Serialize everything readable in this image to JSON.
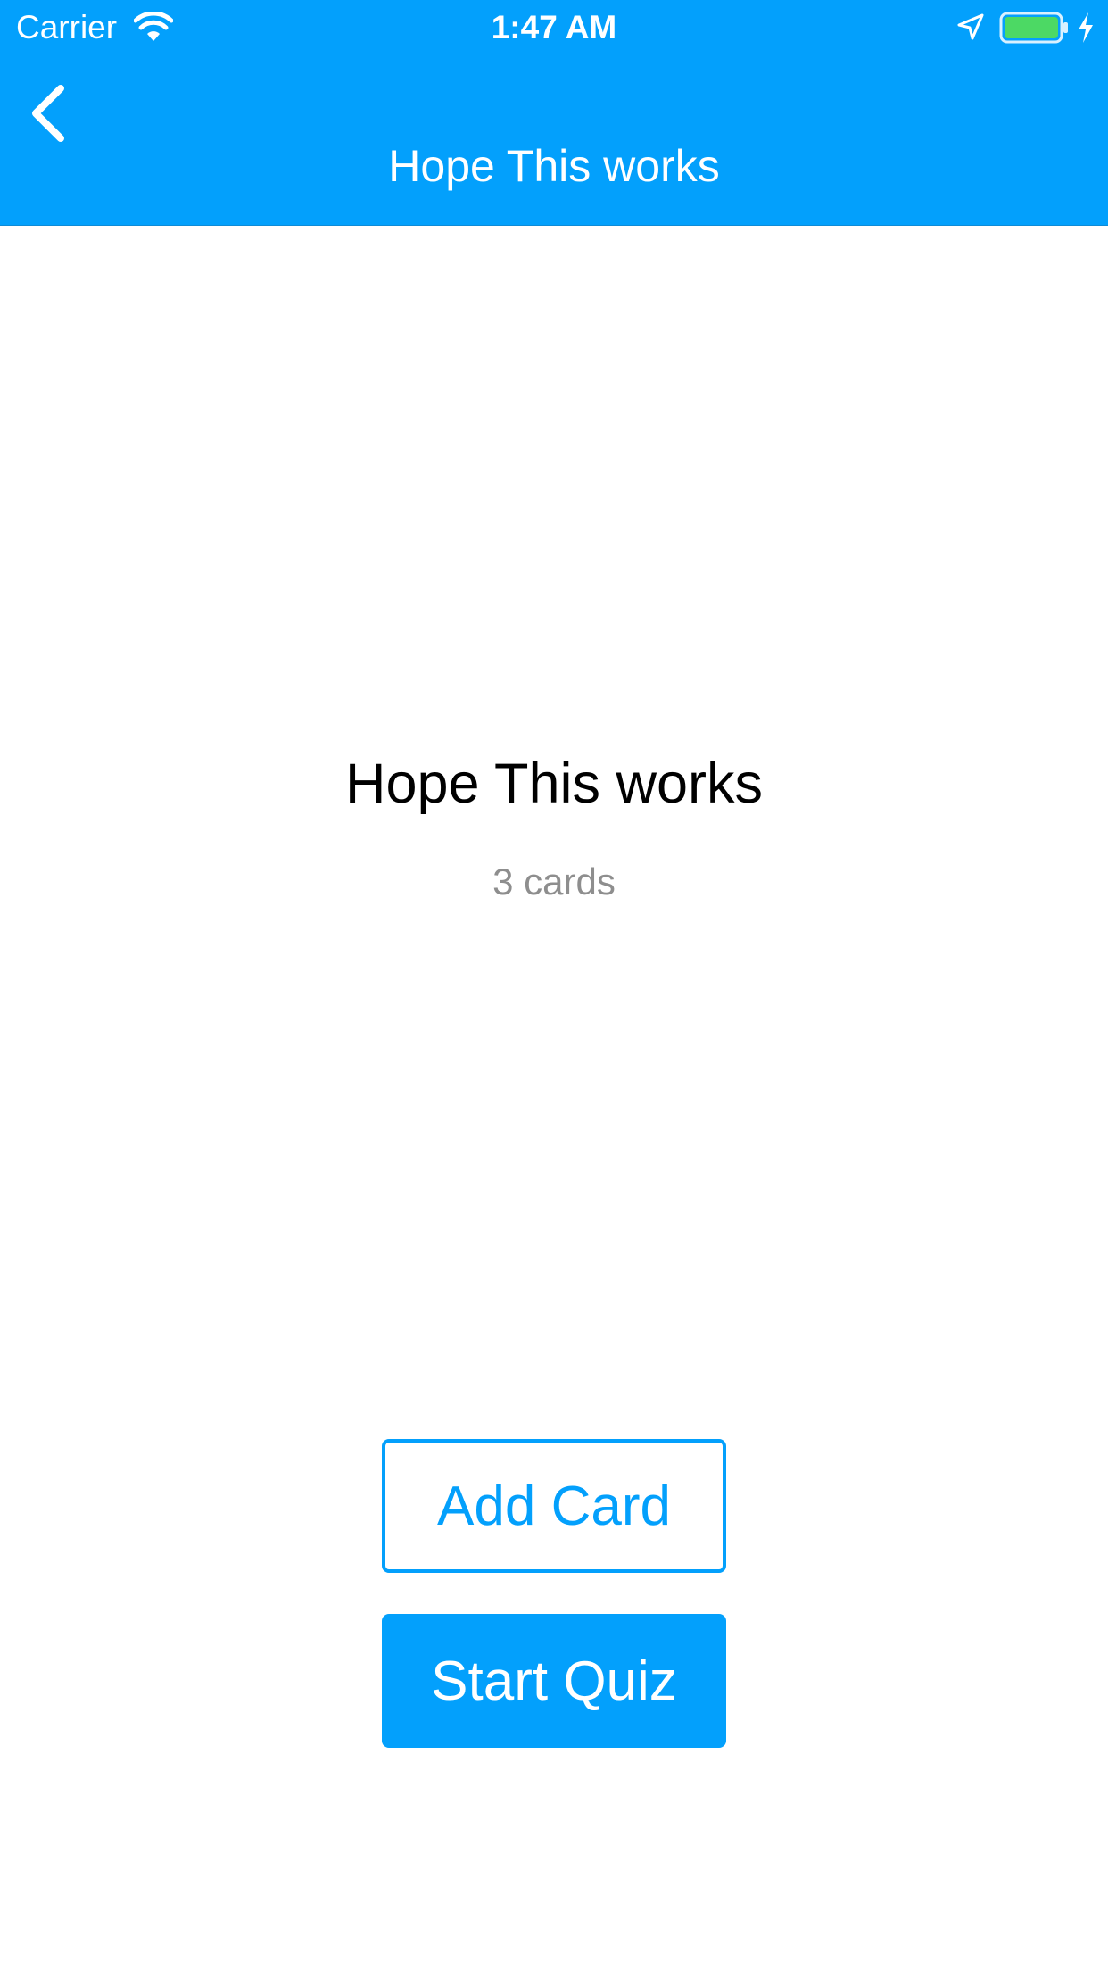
{
  "status_bar": {
    "carrier": "Carrier",
    "time": "1:47 AM",
    "icons": [
      "wifi-icon",
      "location-arrow-icon",
      "battery-icon",
      "charging-bolt-icon"
    ]
  },
  "nav": {
    "back_icon": "chevron-left-icon",
    "title": "Hope This works"
  },
  "deck": {
    "title": "Hope This works",
    "card_count": "3 cards"
  },
  "actions": {
    "add_card_label": "Add Card",
    "start_quiz_label": "Start Quiz"
  },
  "colors": {
    "accent": "#03A0FC",
    "battery_fill": "#4CD964",
    "subtitle": "#8E8E8E",
    "text": "#000000",
    "background": "#FFFFFF"
  }
}
